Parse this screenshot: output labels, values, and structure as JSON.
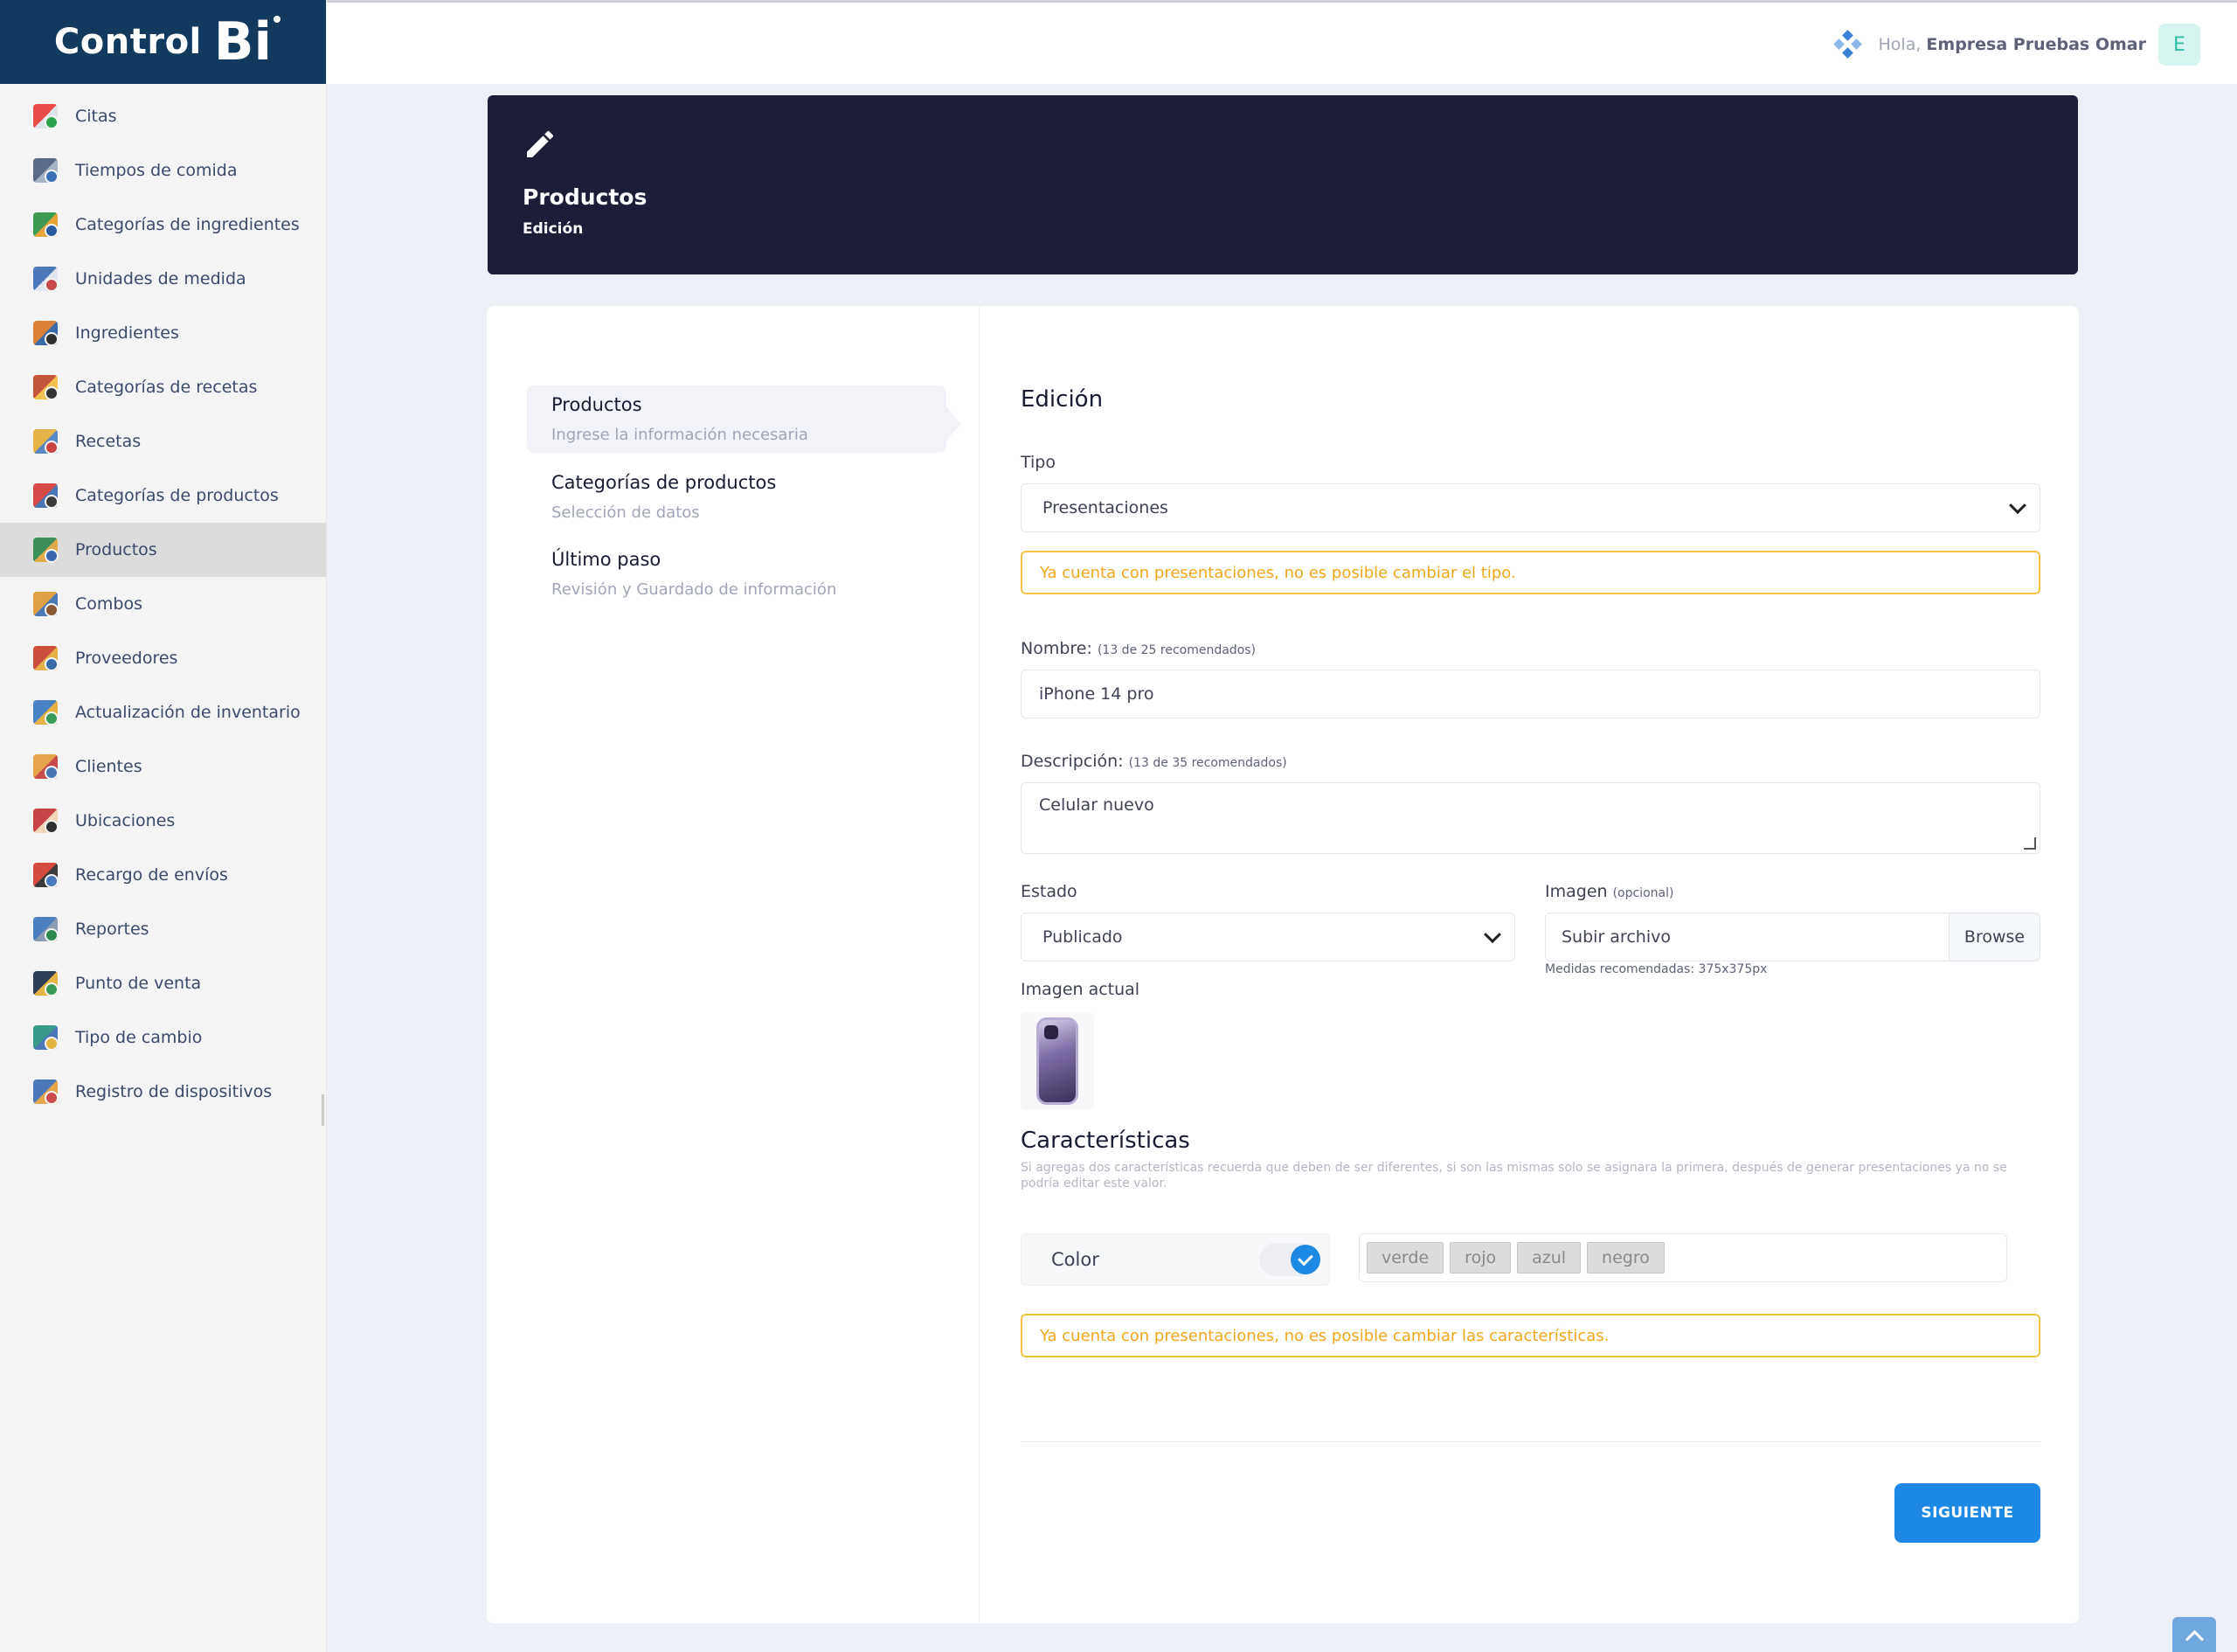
{
  "brand": {
    "text": "Control",
    "mark": "Bi"
  },
  "sidebar": {
    "items": [
      {
        "label": "Citas",
        "icon": "calendar-icon"
      },
      {
        "label": "Tiempos de comida",
        "icon": "clock-icon"
      },
      {
        "label": "Categorías de ingredientes",
        "icon": "ingredients-category-icon"
      },
      {
        "label": "Unidades de medida",
        "icon": "scale-icon"
      },
      {
        "label": "Ingredientes",
        "icon": "ingredients-icon"
      },
      {
        "label": "Categorías de recetas",
        "icon": "recipe-category-icon"
      },
      {
        "label": "Recetas",
        "icon": "recipe-icon"
      },
      {
        "label": "Categorías de productos",
        "icon": "product-category-icon"
      },
      {
        "label": "Productos",
        "icon": "products-icon",
        "active": true
      },
      {
        "label": "Combos",
        "icon": "combo-icon"
      },
      {
        "label": "Proveedores",
        "icon": "supplier-icon"
      },
      {
        "label": "Actualización de inventario",
        "icon": "inventory-icon"
      },
      {
        "label": "Clientes",
        "icon": "clients-icon"
      },
      {
        "label": "Ubicaciones",
        "icon": "location-icon"
      },
      {
        "label": "Recargo de envíos",
        "icon": "delivery-icon"
      },
      {
        "label": "Reportes",
        "icon": "reports-icon"
      },
      {
        "label": "Punto de venta",
        "icon": "pos-icon"
      },
      {
        "label": "Tipo de cambio",
        "icon": "exchange-icon"
      },
      {
        "label": "Registro de dispositivos",
        "icon": "devices-icon"
      }
    ]
  },
  "topbar": {
    "greeting": "Hola,",
    "user_name": "Empresa Pruebas Omar",
    "avatar_letter": "E"
  },
  "banner": {
    "title": "Productos",
    "subtitle": "Edición"
  },
  "steps": [
    {
      "title": "Productos",
      "desc": "Ingrese la información necesaria"
    },
    {
      "title": "Categorías de productos",
      "desc": "Selección de datos"
    },
    {
      "title": "Último paso",
      "desc": "Revisión y Guardado de información"
    }
  ],
  "form": {
    "section_title": "Edición",
    "tipo_label": "Tipo",
    "tipo_value": "Presentaciones",
    "tipo_warning": "Ya cuenta con presentaciones, no es posible cambiar el tipo.",
    "nombre_label": "Nombre:",
    "nombre_hint": "(13 de 25 recomendados)",
    "nombre_value": "iPhone 14 pro",
    "descripcion_label": "Descripción:",
    "descripcion_hint": "(13 de 35 recomendados)",
    "descripcion_value": "Celular nuevo",
    "estado_label": "Estado",
    "estado_value": "Publicado",
    "imagen_label": "Imagen",
    "imagen_hint": "(opcional)",
    "imagen_placeholder": "Subir archivo",
    "browse_label": "Browse",
    "imagen_help": "Medidas recomendadas: 375x375px",
    "imagen_actual_label": "Imagen actual",
    "caracteristicas_title": "Características",
    "caracteristicas_note": "Si agregas dos características recuerda que deben de ser diferentes, si son las mismas solo se asignara la primera, después de generar presentaciones ya no se podría editar este valor.",
    "attribute_name": "Color",
    "attribute_values": [
      "verde",
      "rojo",
      "azul",
      "negro"
    ],
    "caracteristicas_warning": "Ya cuenta con presentaciones, no es posible cambiar las características.",
    "next_button": "SIGUIENTE"
  },
  "colors": {
    "brand": "#12395e",
    "banner": "#1c1d36",
    "primary": "#1e88e5",
    "warning": "#f6c242"
  }
}
